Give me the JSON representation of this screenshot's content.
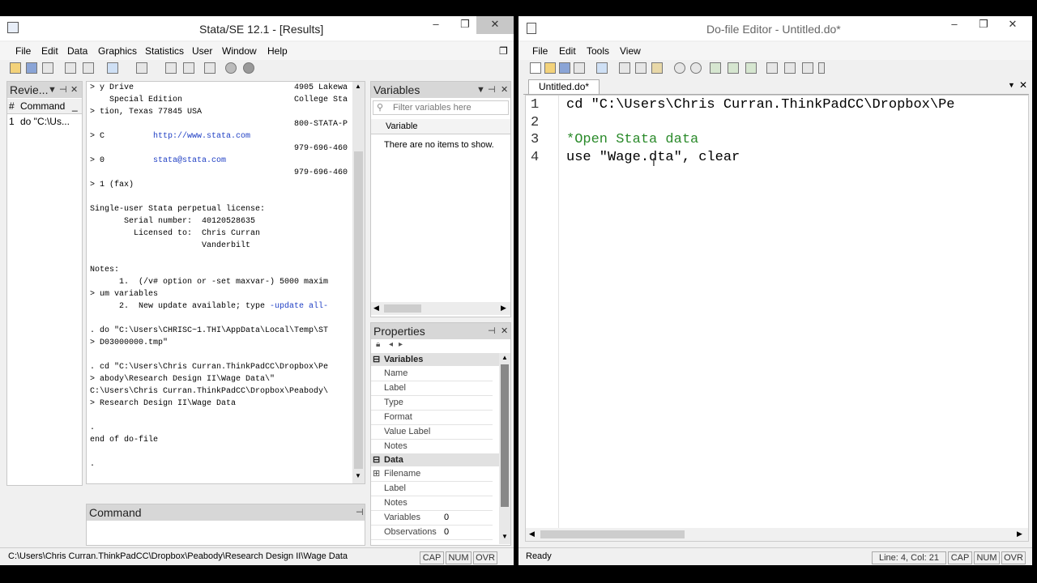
{
  "stata": {
    "title": "Stata/SE 12.1 - [Results]",
    "menu": [
      "File",
      "Edit",
      "Data",
      "Graphics",
      "Statistics",
      "User",
      "Window",
      "Help"
    ],
    "review": {
      "title": "Revie...",
      "col_hash": "#",
      "col_command": "Command",
      "col_extra": "_",
      "row_num": "1",
      "row_cmd": "do \"C:\\Us..."
    },
    "results_lines": [
      {
        "left": "> y Drive",
        "right": "4905 Lakewa"
      },
      {
        "left": "    Special Edition",
        "right": "College Sta"
      },
      {
        "left": "> tion, Texas 77845 USA",
        "right": ""
      },
      {
        "left": "",
        "right": "800-STATA-P"
      },
      {
        "left": "> C          ",
        "link": "http://www.stata.com",
        "right": ""
      },
      {
        "left": "",
        "right": "979-696-460"
      },
      {
        "left": "> 0          ",
        "link": "stata@stata.com",
        "right": ""
      },
      {
        "left": "",
        "right": "979-696-460"
      },
      {
        "left": "> 1 (fax)",
        "right": ""
      },
      {
        "left": "",
        "right": ""
      },
      {
        "left": "Single-user Stata perpetual license:",
        "right": ""
      },
      {
        "left": "       Serial number:  40120528635",
        "right": ""
      },
      {
        "left": "         Licensed to:  Chris Curran",
        "right": ""
      },
      {
        "left": "                       Vanderbilt",
        "right": ""
      },
      {
        "left": "",
        "right": ""
      },
      {
        "left": "Notes:",
        "right": ""
      },
      {
        "left": "      1.  (/v# option or -set maxvar-) 5000 maxim",
        "right": ""
      },
      {
        "left": "> um variables",
        "right": ""
      },
      {
        "left": "      2.  New update available; type ",
        "link": "-update all-",
        "right": ""
      },
      {
        "left": "",
        "right": ""
      },
      {
        "left": ". do \"C:\\Users\\CHRISC~1.THI\\AppData\\Local\\Temp\\ST",
        "right": ""
      },
      {
        "left": "> D03000000.tmp\"",
        "right": ""
      },
      {
        "left": "",
        "right": ""
      },
      {
        "left": ". cd \"C:\\Users\\Chris Curran.ThinkPadCC\\Dropbox\\Pe",
        "right": ""
      },
      {
        "left": "> abody\\Research Design II\\Wage Data\\\"",
        "right": ""
      },
      {
        "left": "C:\\Users\\Chris Curran.ThinkPadCC\\Dropbox\\Peabody\\",
        "right": ""
      },
      {
        "left": "> Research Design II\\Wage Data",
        "right": ""
      },
      {
        "left": "",
        "right": ""
      },
      {
        "left": ".",
        "right": ""
      },
      {
        "left": "end of do-file",
        "right": ""
      },
      {
        "left": "",
        "right": ""
      },
      {
        "left": ".",
        "right": ""
      }
    ],
    "variables": {
      "title": "Variables",
      "filter_placeholder": "Filter variables here",
      "col_variable": "Variable",
      "empty_text": "There are no items to show."
    },
    "properties": {
      "title": "Properties",
      "sec_variables": "Variables",
      "variable_rows": [
        {
          "key": "Name",
          "val": ""
        },
        {
          "key": "Label",
          "val": ""
        },
        {
          "key": "Type",
          "val": ""
        },
        {
          "key": "Format",
          "val": ""
        },
        {
          "key": "Value Label",
          "val": ""
        },
        {
          "key": "Notes",
          "val": ""
        }
      ],
      "sec_data": "Data",
      "data_rows": [
        {
          "key": "Filename",
          "val": ""
        },
        {
          "key": "Label",
          "val": ""
        },
        {
          "key": "Notes",
          "val": ""
        },
        {
          "key": "Variables",
          "val": "0"
        },
        {
          "key": "Observations",
          "val": "0"
        }
      ]
    },
    "command": {
      "title": "Command"
    },
    "status": {
      "path": "C:\\Users\\Chris Curran.ThinkPadCC\\Dropbox\\Peabody\\Research Design II\\Wage Data",
      "cap": "CAP",
      "num": "NUM",
      "ovr": "OVR"
    }
  },
  "dofile": {
    "title": "Do-file Editor - Untitled.do*",
    "menu": [
      "File",
      "Edit",
      "Tools",
      "View"
    ],
    "tab_label": "Untitled.do*",
    "lines": [
      {
        "num": "1",
        "text": "cd \"C:\\Users\\Chris Curran.ThinkPadCC\\Dropbox\\Pe",
        "kind": "code"
      },
      {
        "num": "2",
        "text": "",
        "kind": "code"
      },
      {
        "num": "3",
        "text": "*Open Stata data",
        "kind": "comment"
      },
      {
        "num": "4",
        "text": "use \"Wage.dta\", clear",
        "kind": "code"
      }
    ],
    "status": {
      "ready": "Ready",
      "position": "Line: 4, Col: 21",
      "cap": "CAP",
      "num": "NUM",
      "ovr": "OVR"
    }
  },
  "colors": {
    "comment": "#2a8a2a",
    "link": "#1f3fc4",
    "title_bg": "#ffffff"
  }
}
